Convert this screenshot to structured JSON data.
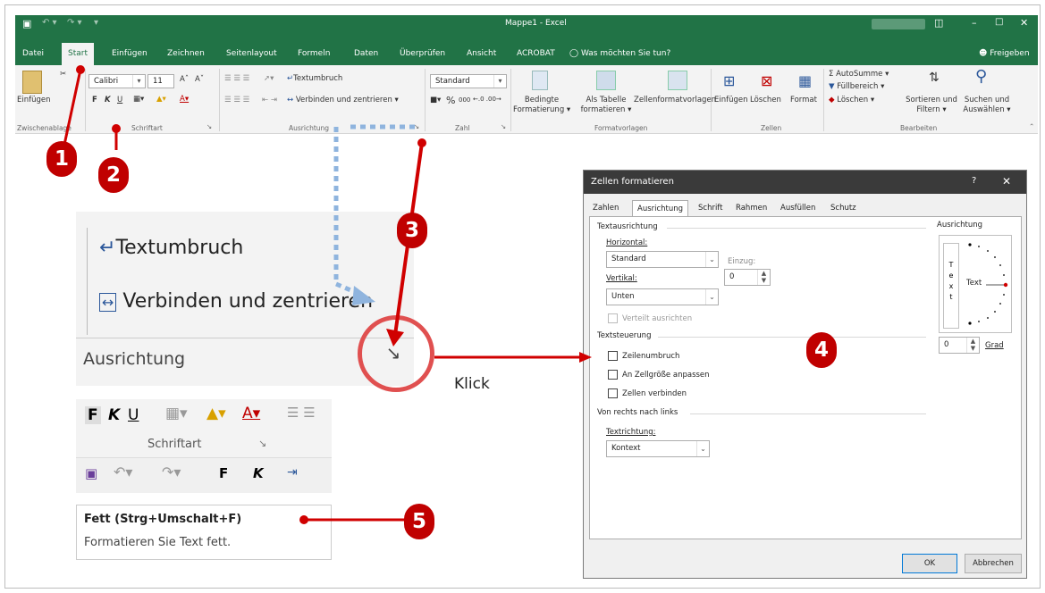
{
  "window": {
    "title": "Mappe1 - Excel",
    "user": "",
    "share_label": "Freigeben"
  },
  "tabs": [
    "Datei",
    "Start",
    "Einfügen",
    "Zeichnen",
    "Seitenlayout",
    "Formeln",
    "Daten",
    "Überprüfen",
    "Ansicht",
    "ACROBAT"
  ],
  "tellme": "Was möchten Sie tun?",
  "ribbon": {
    "paste": "Einfügen",
    "font_name": "Calibri",
    "font_size": "11",
    "bold": "F",
    "italic": "K",
    "underline": "U",
    "wrap": "Textumbruch",
    "merge": "Verbinden und zentrieren",
    "number_format": "Standard",
    "percent": "%",
    "thousands": "000",
    "cond_format": [
      "Bedingte",
      "Formatierung"
    ],
    "as_table": [
      "Als Tabelle",
      "formatieren"
    ],
    "cell_styles": "Zellenformatvorlagen",
    "insert": "Einfügen",
    "delete": "Löschen",
    "format": "Format",
    "autosum": "AutoSumme",
    "fill": "Füllbereich",
    "clear": "Löschen",
    "sort": [
      "Sortieren und",
      "Filtern"
    ],
    "find": [
      "Suchen und",
      "Auswählen"
    ],
    "groups": {
      "clipboard": "Zwischenablage",
      "font": "Schriftart",
      "alignment": "Ausrichtung",
      "number": "Zahl",
      "styles": "Formatvorlagen",
      "cells": "Zellen",
      "editing": "Bearbeiten"
    }
  },
  "badges": [
    "1",
    "2",
    "3",
    "4",
    "5"
  ],
  "zoom": {
    "wrap": "Textumbruch",
    "merge": "Verbinden und zentrieren",
    "group": "Ausrichtung",
    "click_label": "Klick",
    "font_group": "Schriftart",
    "bold": "F",
    "italic": "K",
    "underline": "U"
  },
  "tooltip": {
    "title": "Fett (Strg+Umschalt+F)",
    "desc": "Formatieren Sie Text fett."
  },
  "dialog": {
    "title": "Zellen formatieren",
    "help": "?",
    "tabs": [
      "Zahlen",
      "Ausrichtung",
      "Schrift",
      "Rahmen",
      "Ausfüllen",
      "Schutz"
    ],
    "text_alignment": "Textausrichtung",
    "horizontal_label": "Horizontal:",
    "horizontal_value": "Standard",
    "indent_label": "Einzug:",
    "indent_value": "0",
    "vertical_label": "Vertikal:",
    "vertical_value": "Unten",
    "distributed": "Verteilt ausrichten",
    "text_control": "Textsteuerung",
    "wrap_text": "Zeilenumbruch",
    "shrink": "An Zellgröße anpassen",
    "merge_cells": "Zellen verbinden",
    "rtl": "Von rechts nach links",
    "direction_label": "Textrichtung:",
    "direction_value": "Kontext",
    "orientation": "Ausrichtung",
    "vtext": [
      "T",
      "e",
      "x",
      "t"
    ],
    "text_label": "Text",
    "degree_value": "0",
    "degree_label": "Grad",
    "ok": "OK",
    "cancel": "Abbrechen"
  },
  "colors": {
    "excel_green": "#217346",
    "annotation_red": "#c00000",
    "arrow_blue": "#8fb4de"
  }
}
